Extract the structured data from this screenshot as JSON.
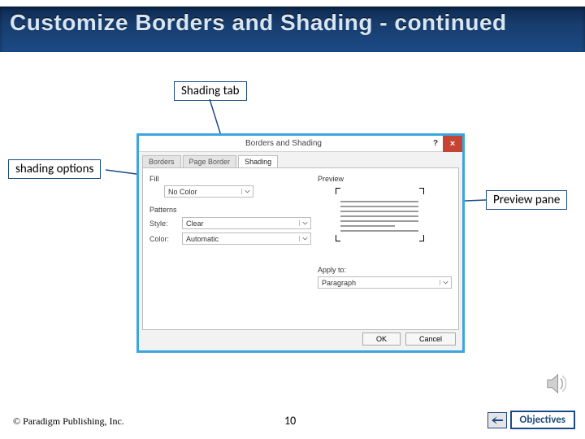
{
  "title": "Customize Borders and Shading - continued",
  "callouts": {
    "shading_tab": "Shading tab",
    "shading_options": "shading options",
    "preview_pane": "Preview pane"
  },
  "dialog": {
    "title": "Borders and Shading",
    "close": "×",
    "help": "?",
    "tabs": {
      "borders": "Borders",
      "page_border": "Page Border",
      "shading": "Shading"
    },
    "fill_label": "Fill",
    "fill_value": "No Color",
    "patterns_label": "Patterns",
    "style_label": "Style:",
    "style_value": "Clear",
    "color_label": "Color:",
    "color_value": "Automatic",
    "preview_label": "Preview",
    "apply_label": "Apply to:",
    "apply_value": "Paragraph",
    "ok": "OK",
    "cancel": "Cancel"
  },
  "footer": {
    "copyright": "© Paradigm Publishing, Inc.",
    "slide_number": "10",
    "objectives": "Objectives"
  }
}
